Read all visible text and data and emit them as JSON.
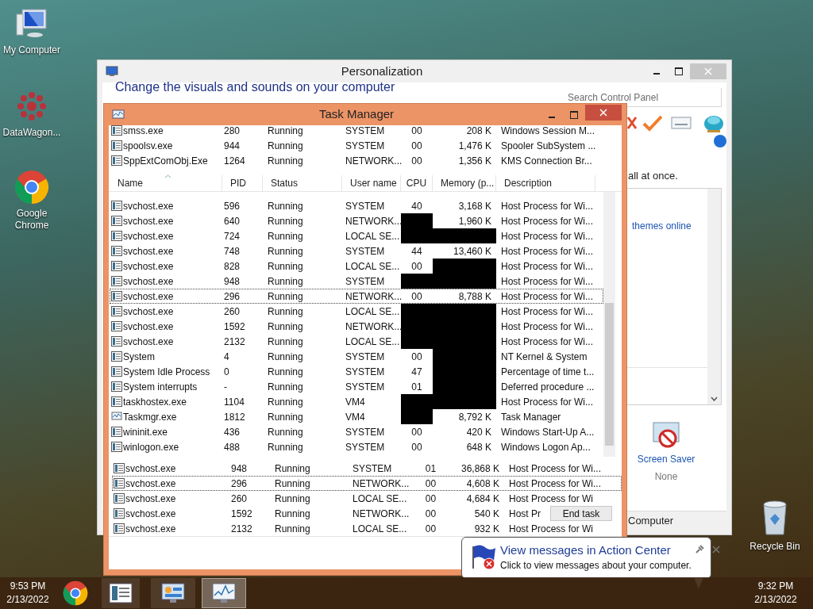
{
  "desktop": {
    "icons": [
      {
        "label": "My Computer",
        "kind": "computer"
      },
      {
        "label": "DataWagon...",
        "kind": "flower"
      },
      {
        "label": "Google Chrome",
        "kind": "chrome"
      }
    ],
    "recycle_bin": {
      "label": "Recycle Bin"
    }
  },
  "personalization": {
    "title": "Personalization",
    "heading": "Change the visuals and sounds on your computer",
    "search_placeholder": "Search Control Panel",
    "fragment": "all at once.",
    "link": "themes online",
    "screen_saver": {
      "label": "Screen Saver",
      "value": "None"
    },
    "footer": "Computer"
  },
  "task_manager": {
    "title": "Task Manager",
    "columns": [
      "Name",
      "PID",
      "Status",
      "User name",
      "CPU",
      "Memory (p...",
      "Description"
    ],
    "ghost_rows": [
      {
        "name": "smss.exe",
        "pid": "280",
        "status": "Running",
        "user": "SYSTEM",
        "cpu": "00",
        "memory": "208 K",
        "description": "Windows Session M...",
        "kind": "app",
        "selected": false,
        "cpu_redacted": false,
        "memory_redacted": false
      },
      {
        "name": "spoolsv.exe",
        "pid": "944",
        "status": "Running",
        "user": "SYSTEM",
        "cpu": "00",
        "memory": "1,476 K",
        "description": "Spooler SubSystem ...",
        "kind": "app",
        "selected": false,
        "cpu_redacted": false,
        "memory_redacted": false
      },
      {
        "name": "SppExtComObj.Exe",
        "pid": "1264",
        "status": "Running",
        "user": "NETWORK...",
        "cpu": "00",
        "memory": "1,356 K",
        "description": "KMS Connection Br...",
        "kind": "app",
        "selected": false,
        "cpu_redacted": false,
        "memory_redacted": false
      }
    ],
    "rows": [
      {
        "name": "svchost.exe",
        "pid": "596",
        "status": "Running",
        "user": "SYSTEM",
        "cpu": "40",
        "memory": "3,168 K",
        "description": "Host Process for Wi...",
        "kind": "app",
        "selected": false,
        "cpu_redacted": false,
        "memory_redacted": false
      },
      {
        "name": "svchost.exe",
        "pid": "640",
        "status": "Running",
        "user": "NETWORK...",
        "memory": "1,960 K",
        "description": "Host Process for Wi...",
        "kind": "app",
        "selected": false,
        "cpu_redacted": true,
        "memory_redacted": false
      },
      {
        "name": "svchost.exe",
        "pid": "724",
        "status": "Running",
        "user": "LOCAL SE...",
        "description": "Host Process for Wi...",
        "kind": "app",
        "selected": false,
        "cpu_redacted": true,
        "memory_redacted": true
      },
      {
        "name": "svchost.exe",
        "pid": "748",
        "status": "Running",
        "user": "SYSTEM",
        "cpu": "44",
        "memory": "13,460 K",
        "description": "Host Process for Wi...",
        "kind": "app",
        "selected": false,
        "cpu_redacted": false,
        "memory_redacted": false
      },
      {
        "name": "svchost.exe",
        "pid": "828",
        "status": "Running",
        "user": "LOCAL SE...",
        "cpu": "00",
        "description": "Host Process for Wi...",
        "kind": "app",
        "selected": false,
        "cpu_redacted": false,
        "memory_redacted": true
      },
      {
        "name": "svchost.exe",
        "pid": "948",
        "status": "Running",
        "user": "SYSTEM",
        "description": "Host Process for Wi...",
        "kind": "app",
        "selected": false,
        "cpu_redacted": true,
        "memory_redacted": true
      },
      {
        "name": "svchost.exe",
        "pid": "296",
        "status": "Running",
        "user": "NETWORK...",
        "cpu": "00",
        "memory": "8,788 K",
        "description": "Host Process for Wi...",
        "kind": "app",
        "selected": true,
        "cpu_redacted": false,
        "memory_redacted": false
      },
      {
        "name": "svchost.exe",
        "pid": "260",
        "status": "Running",
        "user": "LOCAL SE...",
        "description": "Host Process for Wi...",
        "kind": "app",
        "selected": false,
        "cpu_redacted": true,
        "memory_redacted": true
      },
      {
        "name": "svchost.exe",
        "pid": "1592",
        "status": "Running",
        "user": "NETWORK...",
        "description": "Host Process for Wi...",
        "kind": "app",
        "selected": false,
        "cpu_redacted": true,
        "memory_redacted": true
      },
      {
        "name": "svchost.exe",
        "pid": "2132",
        "status": "Running",
        "user": "LOCAL SE...",
        "description": "Host Process for Wi...",
        "kind": "app",
        "selected": false,
        "cpu_redacted": true,
        "memory_redacted": true
      },
      {
        "name": "System",
        "pid": "4",
        "status": "Running",
        "user": "SYSTEM",
        "cpu": "00",
        "description": "NT Kernel & System",
        "kind": "app",
        "selected": false,
        "cpu_redacted": false,
        "memory_redacted": true
      },
      {
        "name": "System Idle Process",
        "pid": "0",
        "status": "Running",
        "user": "SYSTEM",
        "cpu": "47",
        "description": "Percentage of time t...",
        "kind": "app",
        "selected": false,
        "cpu_redacted": false,
        "memory_redacted": true
      },
      {
        "name": "System interrupts",
        "pid": "-",
        "status": "Running",
        "user": "SYSTEM",
        "cpu": "01",
        "description": "Deferred procedure ...",
        "kind": "app",
        "selected": false,
        "cpu_redacted": false,
        "memory_redacted": true
      },
      {
        "name": "taskhostex.exe",
        "pid": "1104",
        "status": "Running",
        "user": "VM4",
        "description": "Host Process for Wi...",
        "kind": "app",
        "selected": false,
        "cpu_redacted": true,
        "memory_redacted": true
      },
      {
        "name": "Taskmgr.exe",
        "pid": "1812",
        "status": "Running",
        "user": "VM4",
        "memory": "8,792 K",
        "description": "Task Manager",
        "kind": "monitor",
        "selected": false,
        "cpu_redacted": true,
        "memory_redacted": false
      },
      {
        "name": "wininit.exe",
        "pid": "436",
        "status": "Running",
        "user": "SYSTEM",
        "cpu": "00",
        "memory": "420 K",
        "description": "Windows Start-Up A...",
        "kind": "app",
        "selected": false,
        "cpu_redacted": false,
        "memory_redacted": false
      },
      {
        "name": "winlogon.exe",
        "pid": "488",
        "status": "Running",
        "user": "SYSTEM",
        "cpu": "00",
        "memory": "648 K",
        "description": "Windows Logon Ap...",
        "kind": "app",
        "selected": false,
        "cpu_redacted": false,
        "memory_redacted": false
      }
    ],
    "lower_rows": [
      {
        "name": "svchost.exe",
        "pid": "948",
        "status": "Running",
        "user": "SYSTEM",
        "cpu": "01",
        "memory": "36,868 K",
        "description": "Host Process for Wi...",
        "kind": "app",
        "selected": false,
        "cpu_redacted": false,
        "memory_redacted": false
      },
      {
        "name": "svchost.exe",
        "pid": "296",
        "status": "Running",
        "user": "NETWORK...",
        "cpu": "00",
        "memory": "4,608 K",
        "description": "Host Process for Wi...",
        "kind": "app",
        "selected": true,
        "cpu_redacted": false,
        "memory_redacted": false
      },
      {
        "name": "svchost.exe",
        "pid": "260",
        "status": "Running",
        "user": "LOCAL SE...",
        "cpu": "00",
        "memory": "4,684 K",
        "description": "Host Process for Wi",
        "kind": "app",
        "selected": false,
        "cpu_redacted": false,
        "memory_redacted": false
      },
      {
        "name": "svchost.exe",
        "pid": "1592",
        "status": "Running",
        "user": "NETWORK...",
        "cpu": "00",
        "memory": "540 K",
        "description": "Host Pr",
        "kind": "app",
        "selected": false,
        "cpu_redacted": false,
        "memory_redacted": false
      },
      {
        "name": "svchost.exe",
        "pid": "2132",
        "status": "Running",
        "user": "LOCAL SE...",
        "cpu": "00",
        "memory": "932 K",
        "description": "Host Process for Wi",
        "kind": "app",
        "selected": false,
        "cpu_redacted": false,
        "memory_redacted": false
      }
    ],
    "end_task": "End task"
  },
  "notification": {
    "title": "View messages in Action Center",
    "message": "Click to view messages about your computer."
  },
  "taskbar": {
    "left_clock": {
      "time": "9:53 PM",
      "date": "2/13/2022"
    },
    "buttons": [
      {
        "kind": "chrome",
        "selected": false
      },
      {
        "kind": "document",
        "selected": false
      },
      {
        "kind": "control-panel",
        "selected": false
      },
      {
        "kind": "task-manager",
        "selected": true
      }
    ],
    "clock": {
      "time": "9:32 PM",
      "date": "2/13/2022"
    }
  }
}
